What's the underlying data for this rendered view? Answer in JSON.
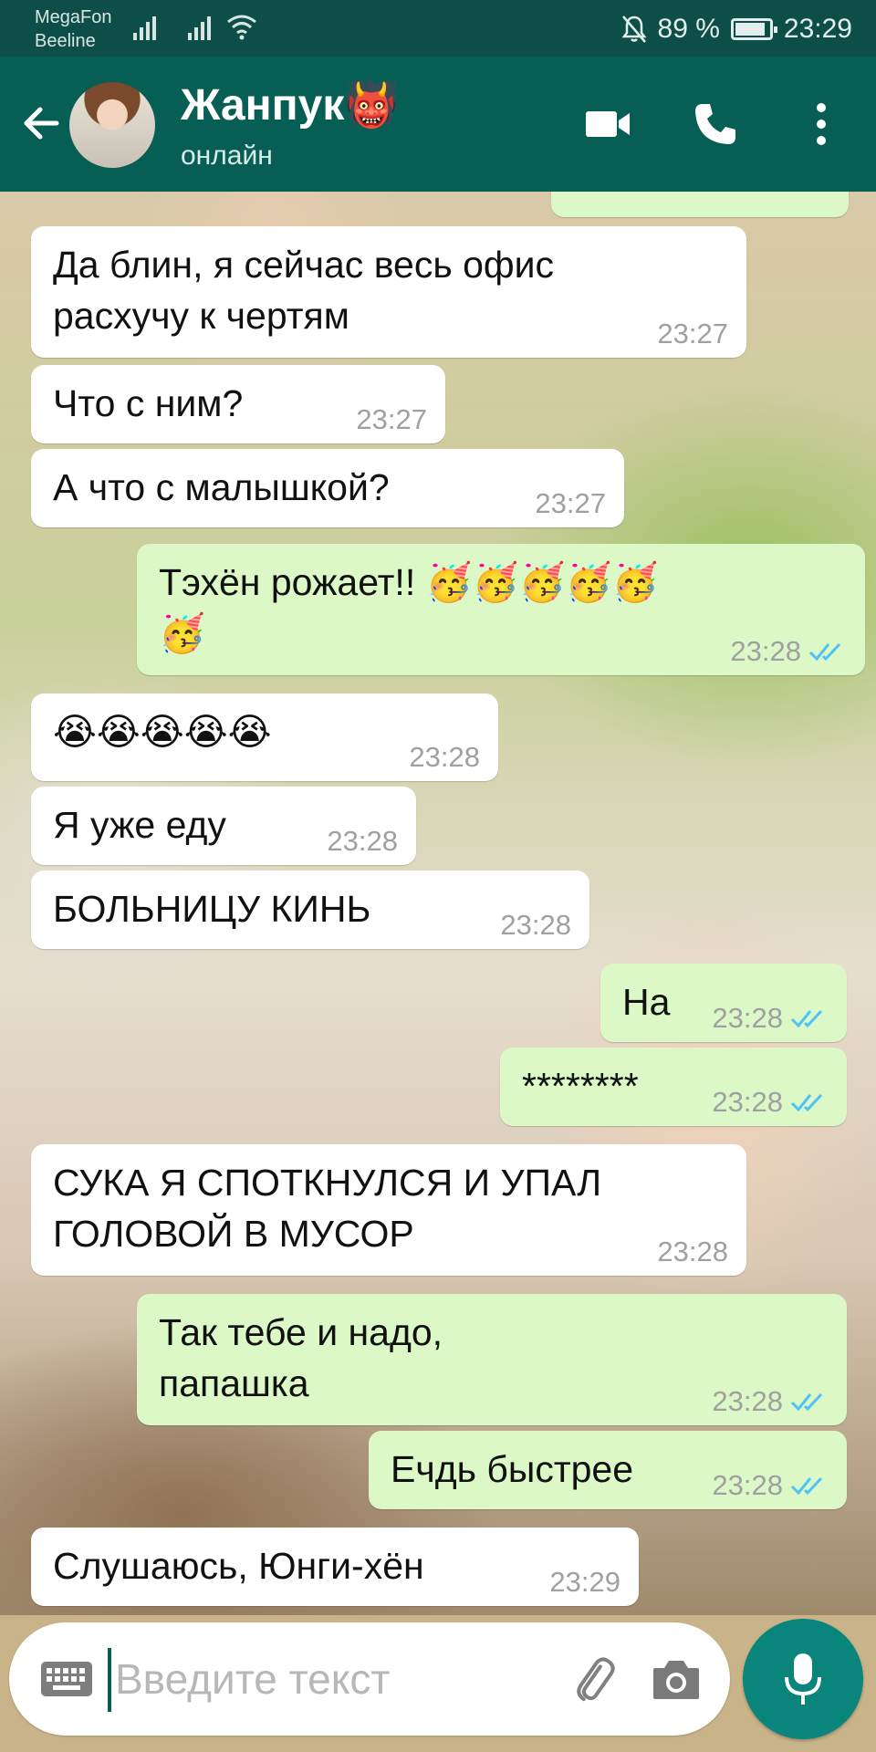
{
  "status_bar": {
    "carrier_1": "MegaFon",
    "carrier_2": "Beeline",
    "battery_text": "89 %",
    "battery_level": 0.89,
    "time": "23:29",
    "icons": [
      "signal-icon",
      "signal-icon",
      "wifi-icon",
      "mute-icon",
      "battery-icon"
    ]
  },
  "header": {
    "contact_name": "Жанпук👹",
    "contact_status": "онлайн",
    "icons": [
      "back-arrow-icon",
      "video-call-icon",
      "phone-call-icon",
      "more-vert-icon"
    ]
  },
  "messages": [
    {
      "dir": "in",
      "text": "Да блин, я сейчас весь офис\nрасхучу к чертям",
      "time": "23:27"
    },
    {
      "dir": "in",
      "text": "Что с ним?",
      "time": "23:27"
    },
    {
      "dir": "in",
      "text": "А что с малышкой?",
      "time": "23:27"
    },
    {
      "dir": "out",
      "text": "Тэхён рожает!! 🥳🥳🥳🥳🥳\n🥳",
      "time": "23:28",
      "read": true
    },
    {
      "dir": "in",
      "text": "😭😭😭😭😭",
      "time": "23:28"
    },
    {
      "dir": "in",
      "text": "Я уже еду",
      "time": "23:28"
    },
    {
      "dir": "in",
      "text": "БОЛЬНИЦУ КИНЬ",
      "time": "23:28"
    },
    {
      "dir": "out",
      "text": "На",
      "time": "23:28",
      "read": true
    },
    {
      "dir": "out",
      "text": "********",
      "time": "23:28",
      "read": true
    },
    {
      "dir": "in",
      "text": "СУКА Я СПОТКНУЛСЯ И УПАЛ\nГОЛОВОЙ В МУСОР",
      "time": "23:28"
    },
    {
      "dir": "out",
      "text": "Так тебе и надо,\nпапашка",
      "time": "23:28",
      "read": true
    },
    {
      "dir": "out",
      "text": "Ечдь быстрее",
      "time": "23:28",
      "read": true
    },
    {
      "dir": "in",
      "text": "Слушаюсь, Юнги-хён",
      "time": "23:29"
    }
  ],
  "composer": {
    "placeholder": "Введите текст",
    "value": "",
    "icons": [
      "keyboard-icon",
      "attach-icon",
      "camera-icon",
      "microphone-icon"
    ]
  },
  "colors": {
    "header": "#075e54",
    "status_bar": "#0d4f48",
    "outgoing_bubble": "#dcf8c6",
    "incoming_bubble": "#ffffff",
    "read_ticks": "#4fc3f7",
    "mic_button": "#0a857b"
  }
}
